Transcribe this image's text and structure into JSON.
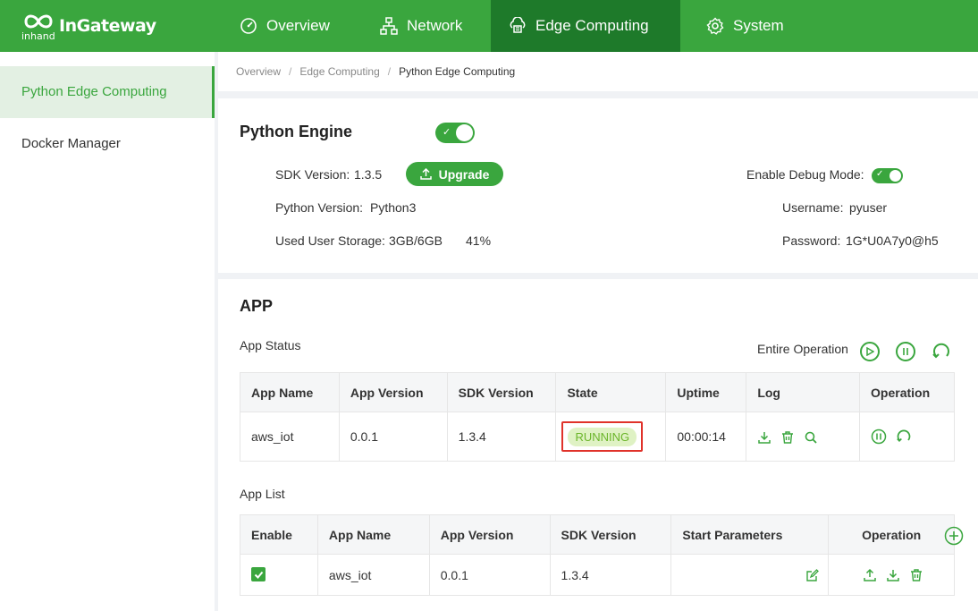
{
  "app": {
    "brand": "InGateway",
    "brand_sub": "inhand"
  },
  "nav": [
    {
      "label": "Overview",
      "icon": "dashboard-icon"
    },
    {
      "label": "Network",
      "icon": "network-icon"
    },
    {
      "label": "Edge Computing",
      "icon": "edge-computing-icon",
      "active": true
    },
    {
      "label": "System",
      "icon": "gear-icon"
    }
  ],
  "sidebar": {
    "items": [
      {
        "label": "Python Edge Computing",
        "active": true
      },
      {
        "label": "Docker Manager"
      }
    ]
  },
  "breadcrumb": [
    "Overview",
    "Edge Computing",
    "Python Edge Computing"
  ],
  "engine": {
    "title": "Python Engine",
    "enabled": true,
    "sdk_version_label": "SDK Version:",
    "sdk_version": "1.3.5",
    "upgrade_label": "Upgrade",
    "python_version_label": "Python Version:",
    "python_version": "Python3",
    "storage_label": "Used User Storage:",
    "storage_value": "3GB/6GB",
    "storage_percent": "41%",
    "debug_label": "Enable Debug Mode:",
    "debug_enabled": true,
    "username_label": "Username:",
    "username": "pyuser",
    "password_label": "Password:",
    "password": "1G*U0A7y0@h5"
  },
  "app_section": {
    "title": "APP",
    "status_label": "App Status",
    "entire_operation_label": "Entire Operation",
    "status_table": {
      "headers": [
        "App Name",
        "App Version",
        "SDK Version",
        "State",
        "Uptime",
        "Log",
        "Operation"
      ],
      "rows": [
        {
          "app_name": "aws_iot",
          "app_version": "0.0.1",
          "sdk_version": "1.3.4",
          "state": "RUNNING",
          "uptime": "00:00:14"
        }
      ]
    },
    "list_label": "App List",
    "list_table": {
      "headers": [
        "Enable",
        "App Name",
        "App Version",
        "SDK Version",
        "Start Parameters",
        "Operation"
      ],
      "rows": [
        {
          "enabled": true,
          "app_name": "aws_iot",
          "app_version": "0.0.1",
          "sdk_version": "1.3.4",
          "start_parameters": ""
        }
      ]
    }
  },
  "colors": {
    "brand_green": "#3aa63e",
    "nav_active": "#1e7a2a",
    "running_bg": "#dff2c4",
    "running_text": "#6bb52a",
    "highlight_red": "#e0322a"
  }
}
